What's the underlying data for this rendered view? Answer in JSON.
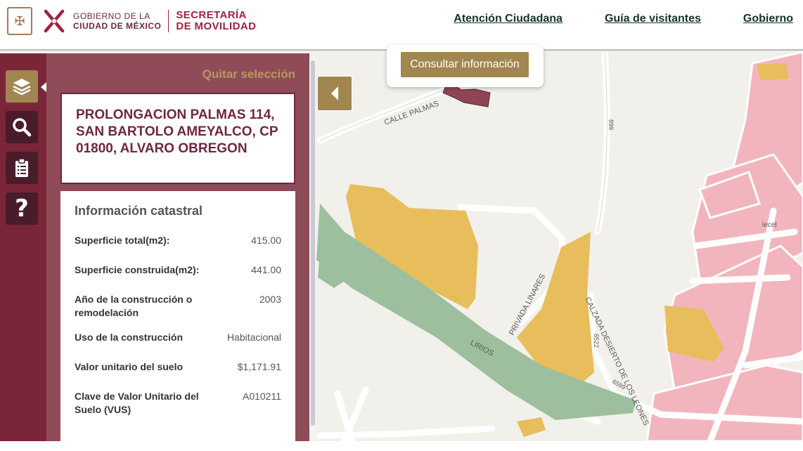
{
  "header": {
    "gov_line1": "GOBIERNO DE LA",
    "gov_line2": "CIUDAD DE MÉXICO",
    "sec_line1": "SECRETARÍA",
    "sec_line2": "DE MOVILIDAD",
    "nav": [
      "Atención Ciudadana",
      "Guía de visitantes",
      "Gobierno"
    ]
  },
  "sidebar": {
    "tools": [
      {
        "icon": "layers-icon",
        "active": true
      },
      {
        "icon": "search-icon",
        "active": false
      },
      {
        "icon": "clipboard-icon",
        "active": false
      },
      {
        "icon": "help-icon",
        "active": false
      }
    ]
  },
  "panel": {
    "clear_selection": "Quitar selección",
    "address": "PROLONGACION PALMAS 114, SAN BARTOLO AMEYALCO, CP 01800, ALVARO OBREGON",
    "info_title": "Información catastral",
    "rows": [
      {
        "label": "Superficie total(m2):",
        "value": "415.00"
      },
      {
        "label": "Superficie construida(m2):",
        "value": "441.00"
      },
      {
        "label": "Año de la construcción o remodelación",
        "value": "2003"
      },
      {
        "label": "Uso de la construcción",
        "value": "Habitacional"
      },
      {
        "label": "Valor unitario del suelo",
        "value": "$1,171.91"
      },
      {
        "label": "Clave de Valor Unitario del Suelo (VUS)",
        "value": "A010211"
      }
    ]
  },
  "map": {
    "popup_button": "Consultar información",
    "streets": [
      "CALLE PALMAS",
      "PRIVADA LINARES",
      "CALZADA DESIERTO DE LOS LEONES",
      "LIRIOS"
    ],
    "numbers": [
      "899",
      "6522",
      "6599"
    ],
    "poi": "lecel",
    "colors": {
      "residential": "#f2b5bd",
      "commercial": "#e8bd5c",
      "green": "#9dbf9e"
    }
  }
}
